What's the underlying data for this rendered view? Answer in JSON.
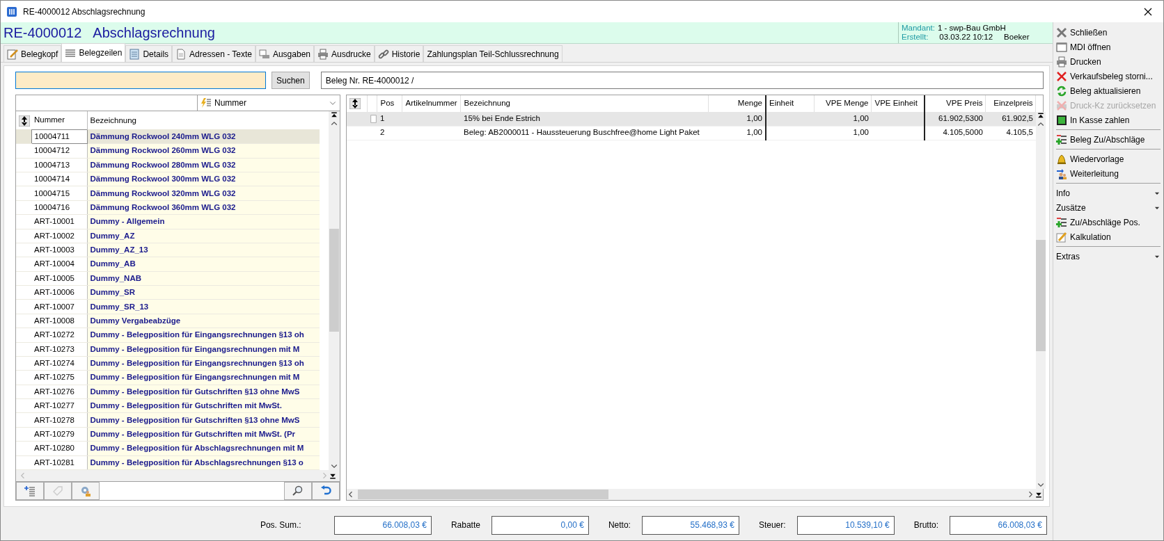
{
  "window": {
    "title": "RE-4000012 Abschlagsrechnung"
  },
  "header": {
    "number": "RE-4000012",
    "type": "Abschlagsrechnung",
    "mandant_label": "Mandant:",
    "mandant": "1 - swp-Bau GmbH",
    "erstellt_label": "Erstellt:",
    "erstellt_date": "03.03.22 10:12",
    "erstellt_user": "Boeker"
  },
  "tabs": [
    {
      "label": "Belegkopf",
      "selected": false
    },
    {
      "label": "Belegzeilen",
      "selected": true
    },
    {
      "label": "Details",
      "selected": false
    },
    {
      "label": "Adressen - Texte",
      "selected": false
    },
    {
      "label": "Ausgaben",
      "selected": false
    },
    {
      "label": "Ausdrucke",
      "selected": false
    },
    {
      "label": "Historie",
      "selected": false
    },
    {
      "label": "Zahlungsplan Teil-Schlussrechnung",
      "selected": false
    }
  ],
  "search": {
    "button": "Suchen"
  },
  "beleg_field": {
    "value": "Beleg Nr. RE-4000012 /"
  },
  "article_list": {
    "sort_field": "Nummer",
    "columns": [
      "Nummer",
      "Bezeichnung"
    ],
    "rows": [
      {
        "nummer": "10004711",
        "bezeichnung": "Dämmung Rockwool 240mm WLG 032",
        "selected": true
      },
      {
        "nummer": "10004712",
        "bezeichnung": "Dämmung Rockwool 260mm WLG 032",
        "selected": false
      },
      {
        "nummer": "10004713",
        "bezeichnung": "Dämmung Rockwool 280mm WLG 032",
        "selected": false
      },
      {
        "nummer": "10004714",
        "bezeichnung": "Dämmung Rockwool 300mm WLG 032",
        "selected": false
      },
      {
        "nummer": "10004715",
        "bezeichnung": "Dämmung Rockwool 320mm WLG 032",
        "selected": false
      },
      {
        "nummer": "10004716",
        "bezeichnung": "Dämmung Rockwool 360mm WLG 032",
        "selected": false
      },
      {
        "nummer": "ART-10001",
        "bezeichnung": "Dummy - Allgemein",
        "selected": false
      },
      {
        "nummer": "ART-10002",
        "bezeichnung": "Dummy_AZ",
        "selected": false
      },
      {
        "nummer": "ART-10003",
        "bezeichnung": "Dummy_AZ_13",
        "selected": false
      },
      {
        "nummer": "ART-10004",
        "bezeichnung": "Dummy_AB",
        "selected": false
      },
      {
        "nummer": "ART-10005",
        "bezeichnung": "Dummy_NAB",
        "selected": false
      },
      {
        "nummer": "ART-10006",
        "bezeichnung": "Dummy_SR",
        "selected": false
      },
      {
        "nummer": "ART-10007",
        "bezeichnung": "Dummy_SR_13",
        "selected": false
      },
      {
        "nummer": "ART-10008",
        "bezeichnung": "Dummy Vergabeabzüge",
        "selected": false
      },
      {
        "nummer": "ART-10272",
        "bezeichnung": "Dummy - Belegposition für Eingangsrechnungen §13 oh",
        "selected": false
      },
      {
        "nummer": "ART-10273",
        "bezeichnung": "Dummy - Belegposition für Eingangsrechnungen mit M",
        "selected": false
      },
      {
        "nummer": "ART-10274",
        "bezeichnung": "Dummy - Belegposition für Eingangsrechnungen §13 oh",
        "selected": false
      },
      {
        "nummer": "ART-10275",
        "bezeichnung": "Dummy - Belegposition für Eingangsrechnungen mit M",
        "selected": false
      },
      {
        "nummer": "ART-10276",
        "bezeichnung": "Dummy - Belegposition für Gutschriften §13 ohne MwS",
        "selected": false
      },
      {
        "nummer": "ART-10277",
        "bezeichnung": "Dummy - Belegposition für Gutschriften mit MwSt.",
        "selected": false
      },
      {
        "nummer": "ART-10278",
        "bezeichnung": "Dummy - Belegposition für Gutschriften §13 ohne MwS",
        "selected": false
      },
      {
        "nummer": "ART-10279",
        "bezeichnung": "Dummy - Belegposition für Gutschriften mit MwSt. (Pr",
        "selected": false
      },
      {
        "nummer": "ART-10280",
        "bezeichnung": "Dummy - Belegposition für Abschlagsrechnungen mit M",
        "selected": false
      },
      {
        "nummer": "ART-10281",
        "bezeichnung": "Dummy - Belegposition für Abschlagsrechnungen §13 o",
        "selected": false
      }
    ]
  },
  "positions": {
    "columns": [
      "Pos",
      "Artikelnummer",
      "Bezeichnung",
      "Menge",
      "Einheit",
      "VPE Menge",
      "VPE Einheit",
      "VPE Preis",
      "Einzelpreis"
    ],
    "rows": [
      {
        "cells": [
          "1",
          "",
          "15% bei Ende Estrich",
          "1,00",
          "",
          "1,00",
          "",
          "61.902,5300",
          "61.902,5"
        ],
        "selected": true
      },
      {
        "cells": [
          "2",
          "",
          "Beleg: AB2000011 - Haussteuerung Buschfree@home Light Paket",
          "1,00",
          "",
          "1,00",
          "",
          "4.105,5000",
          "4.105,5"
        ],
        "selected": false
      }
    ]
  },
  "totals": [
    {
      "label": "Pos. Sum.:",
      "value": "66.008,03 €"
    },
    {
      "label": "Rabatte",
      "value": "0,00 €"
    },
    {
      "label": "Netto:",
      "value": "55.468,93 €"
    },
    {
      "label": "Steuer:",
      "value": "10.539,10 €"
    },
    {
      "label": "Brutto:",
      "value": "66.008,03 €"
    }
  ],
  "sidebar": {
    "groups": [
      [
        {
          "kind": "action",
          "label": "Schließen",
          "disabled": false
        },
        {
          "kind": "action",
          "label": "MDI öffnen",
          "disabled": false
        },
        {
          "kind": "action",
          "label": "Drucken",
          "disabled": false
        },
        {
          "kind": "action",
          "label": "Verkaufsbeleg storni...",
          "disabled": false
        },
        {
          "kind": "action",
          "label": "Beleg aktualisieren",
          "disabled": false
        },
        {
          "kind": "action",
          "label": "Druck-Kz zurücksetzen",
          "disabled": true
        },
        {
          "kind": "action",
          "label": "In Kasse zahlen",
          "disabled": false
        }
      ],
      [
        {
          "kind": "action",
          "label": "Beleg Zu/Abschläge",
          "disabled": false
        }
      ],
      [
        {
          "kind": "action",
          "label": "Wiedervorlage",
          "disabled": false
        },
        {
          "kind": "action",
          "label": "Weiterleitung",
          "disabled": false
        }
      ],
      [
        {
          "kind": "section",
          "label": "Info"
        },
        {
          "kind": "section",
          "label": "Zusätze"
        },
        {
          "kind": "action",
          "label": "Zu/Abschläge Pos.",
          "disabled": false
        },
        {
          "kind": "action",
          "label": "Kalkulation",
          "disabled": false
        }
      ],
      [
        {
          "kind": "section",
          "label": "Extras"
        }
      ]
    ]
  }
}
